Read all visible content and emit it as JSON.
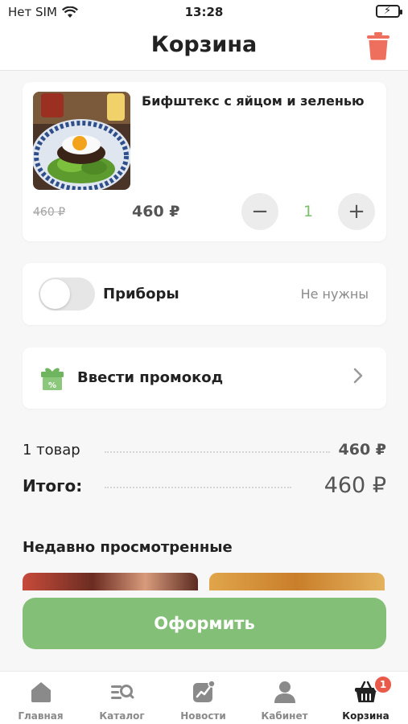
{
  "status_bar": {
    "carrier": "Нет SIM",
    "time": "13:28"
  },
  "header": {
    "title": "Корзина"
  },
  "cart_item": {
    "name": "Бифштекс с яйцом и зеленью",
    "old_price": "460 ₽",
    "price": "460 ₽",
    "quantity": "1",
    "minus_label": "−",
    "plus_label": "+"
  },
  "cutlery": {
    "label": "Приборы",
    "value": "Не нужны",
    "enabled": false
  },
  "promo": {
    "label": "Ввести промокод"
  },
  "summary": {
    "items_label": "1 товар",
    "items_value": "460 ₽",
    "total_label": "Итого:",
    "total_value": "460 ₽"
  },
  "recent": {
    "title": "Недавно просмотренные"
  },
  "checkout": {
    "label": "Оформить"
  },
  "tabbar": {
    "items": [
      {
        "label": "Главная",
        "icon": "home-icon"
      },
      {
        "label": "Каталог",
        "icon": "catalog-search-icon"
      },
      {
        "label": "Новости",
        "icon": "news-chart-icon"
      },
      {
        "label": "Кабинет",
        "icon": "person-icon"
      },
      {
        "label": "Корзина",
        "icon": "basket-icon",
        "badge": "1",
        "active": true
      }
    ]
  },
  "colors": {
    "accent_green": "#83bf77",
    "quantity_green": "#7cbf6b",
    "trash_red": "#ef6f5e",
    "badge_red": "#ea5a4b"
  }
}
